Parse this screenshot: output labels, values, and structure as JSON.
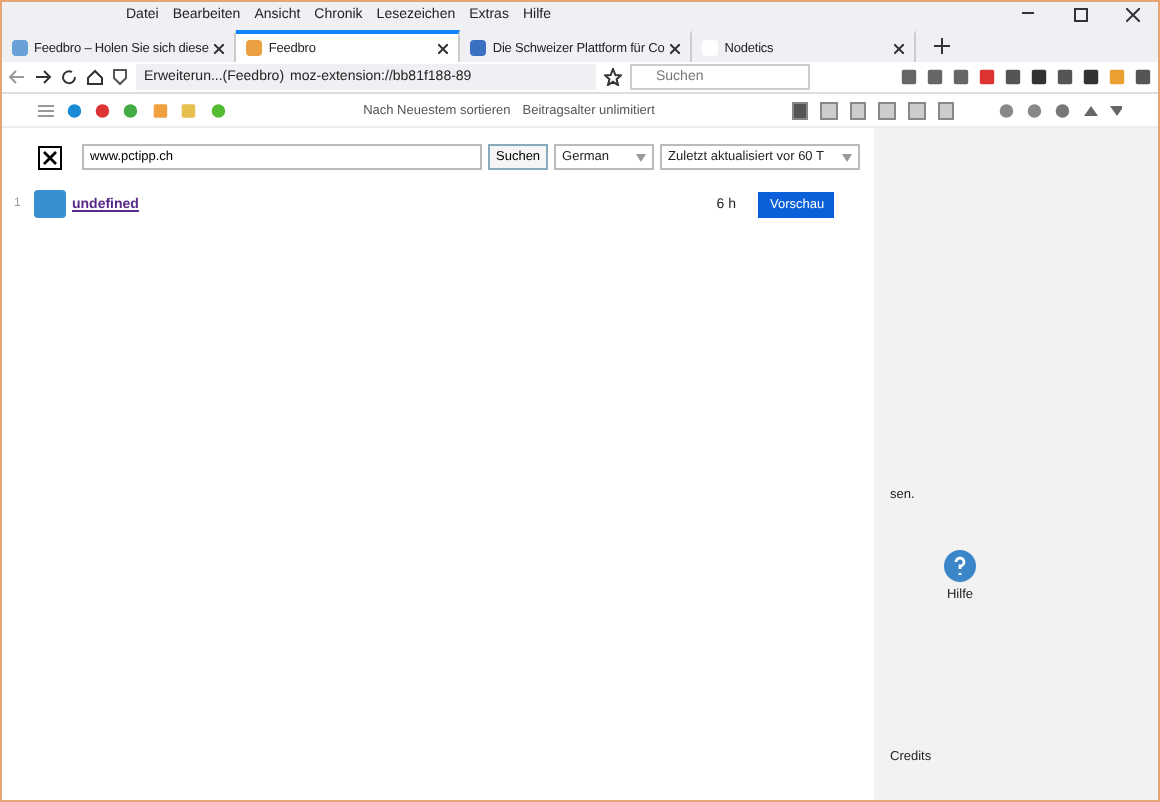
{
  "menu": [
    "Datei",
    "Bearbeiten",
    "Ansicht",
    "Chronik",
    "Lesezeichen",
    "Extras",
    "Hilfe"
  ],
  "tabs": [
    {
      "title": "Feedbro – Holen Sie sich diese",
      "selected": false
    },
    {
      "title": "Feedbro",
      "selected": true
    },
    {
      "title": "Die Schweizer Plattform für Co",
      "selected": false
    },
    {
      "title": "Nodetics",
      "selected": false
    }
  ],
  "navigation": {
    "identity": "Erweiterun...(Feedbro)",
    "url": "moz-extension://bb81f188-89",
    "search": {
      "placeholder": "Suchen"
    }
  },
  "feed_toolbar": {
    "sort": "Nach Neuestem sortieren",
    "age_filter": "Beitragsalter unlimitiert",
    "view_modes": [
      {
        "selected": true
      },
      {
        "selected": false
      },
      {
        "selected": false
      },
      {
        "selected": false
      },
      {
        "selected": false
      },
      {
        "selected": false
      }
    ]
  },
  "search_bar": {
    "value": "www.pctipp.ch",
    "button": "Suchen",
    "language": "German",
    "updated": "Zuletzt aktualisiert vor 60 T"
  },
  "results": [
    {
      "number": "1",
      "title": "undefined",
      "age": "6 h",
      "button": "Vorschau"
    }
  ],
  "side_panel": {
    "text": "sen.",
    "help": "Hilfe",
    "credits": "Credits"
  }
}
